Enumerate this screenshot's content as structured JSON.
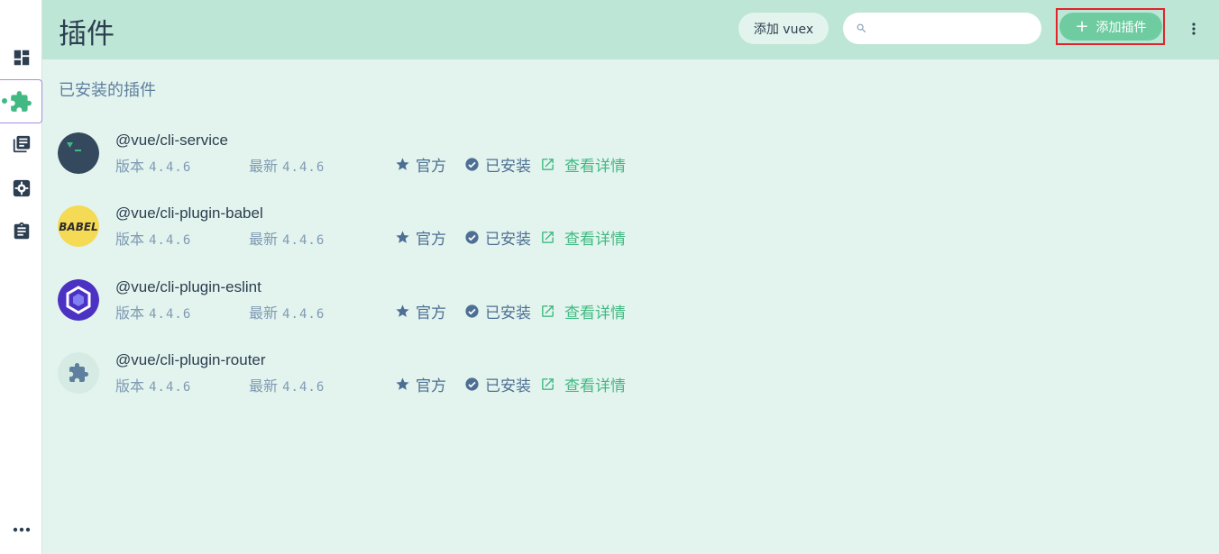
{
  "header": {
    "title": "插件",
    "vuex_button": "添加 vuex",
    "search_placeholder": "",
    "add_plugin_button": "添加插件"
  },
  "sidebar": {
    "items": [
      {
        "name": "dashboard",
        "icon": "dashboard-icon"
      },
      {
        "name": "plugins",
        "icon": "puzzle-icon",
        "active": true
      },
      {
        "name": "dependencies",
        "icon": "library-books-icon"
      },
      {
        "name": "configuration",
        "icon": "gear-icon"
      },
      {
        "name": "tasks",
        "icon": "clipboard-icon"
      }
    ],
    "more_icon": "more-horizontal-icon"
  },
  "main": {
    "section_title": "已安装的插件",
    "plugins": [
      {
        "name": "@vue/cli-service",
        "version_label": "版本",
        "version": "4.4.6",
        "latest_label": "最新",
        "latest": "4.4.6",
        "official": "官方",
        "installed": "已安装",
        "details": "查看详情",
        "logo": "terminal-logo"
      },
      {
        "name": "@vue/cli-plugin-babel",
        "version_label": "版本",
        "version": "4.4.6",
        "latest_label": "最新",
        "latest": "4.4.6",
        "official": "官方",
        "installed": "已安装",
        "details": "查看详情",
        "logo": "babel-logo",
        "logo_text": "BABEL"
      },
      {
        "name": "@vue/cli-plugin-eslint",
        "version_label": "版本",
        "version": "4.4.6",
        "latest_label": "最新",
        "latest": "4.4.6",
        "official": "官方",
        "installed": "已安装",
        "details": "查看详情",
        "logo": "eslint-logo"
      },
      {
        "name": "@vue/cli-plugin-router",
        "version_label": "版本",
        "version": "4.4.6",
        "latest_label": "最新",
        "latest": "4.4.6",
        "official": "官方",
        "installed": "已安装",
        "details": "查看详情",
        "logo": "puzzle-logo"
      }
    ]
  },
  "colors": {
    "accent": "#42b983",
    "header_bg": "#bde6d6",
    "page_bg": "#e3f4ee",
    "highlight_border": "#e0252b"
  }
}
